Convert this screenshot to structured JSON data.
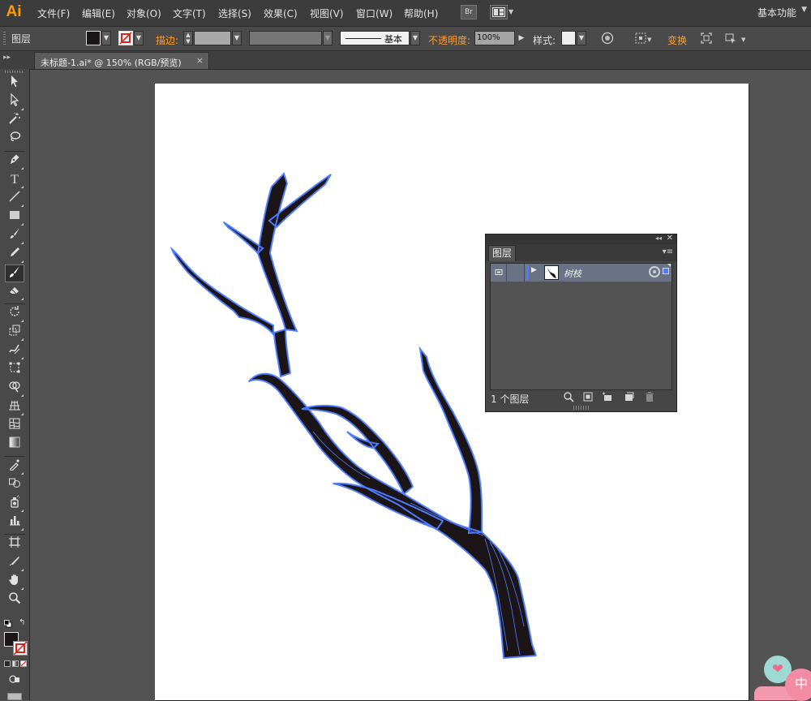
{
  "app": {
    "logo": "Ai"
  },
  "menu": {
    "items": [
      "文件(F)",
      "编辑(E)",
      "对象(O)",
      "文字(T)",
      "选择(S)",
      "效果(C)",
      "视图(V)",
      "窗口(W)",
      "帮助(H)"
    ],
    "bridge_label": "Br",
    "workspace": "基本功能"
  },
  "control_bar": {
    "panel_label": "图层",
    "stroke_label": "描边:",
    "stroke_profile": "基本",
    "opacity_label": "不透明度:",
    "opacity_value": "100%",
    "style_label": "样式:",
    "transform_label": "变换"
  },
  "document": {
    "tab_title": "未标题-1.ai* @ 150% (RGB/预览)",
    "close_glyph": "×"
  },
  "layers_panel": {
    "tab": "图层",
    "layer_name": "树枝",
    "layer_count": "1 个图层"
  },
  "badges": {
    "chinese": "中"
  },
  "colors": {
    "ui_bg": "#535353",
    "menubar": "#3c3c3c",
    "accent_orange": "#ff9d2e",
    "selection_blue": "#4f7cff",
    "branch_fill": "#1c1517"
  }
}
